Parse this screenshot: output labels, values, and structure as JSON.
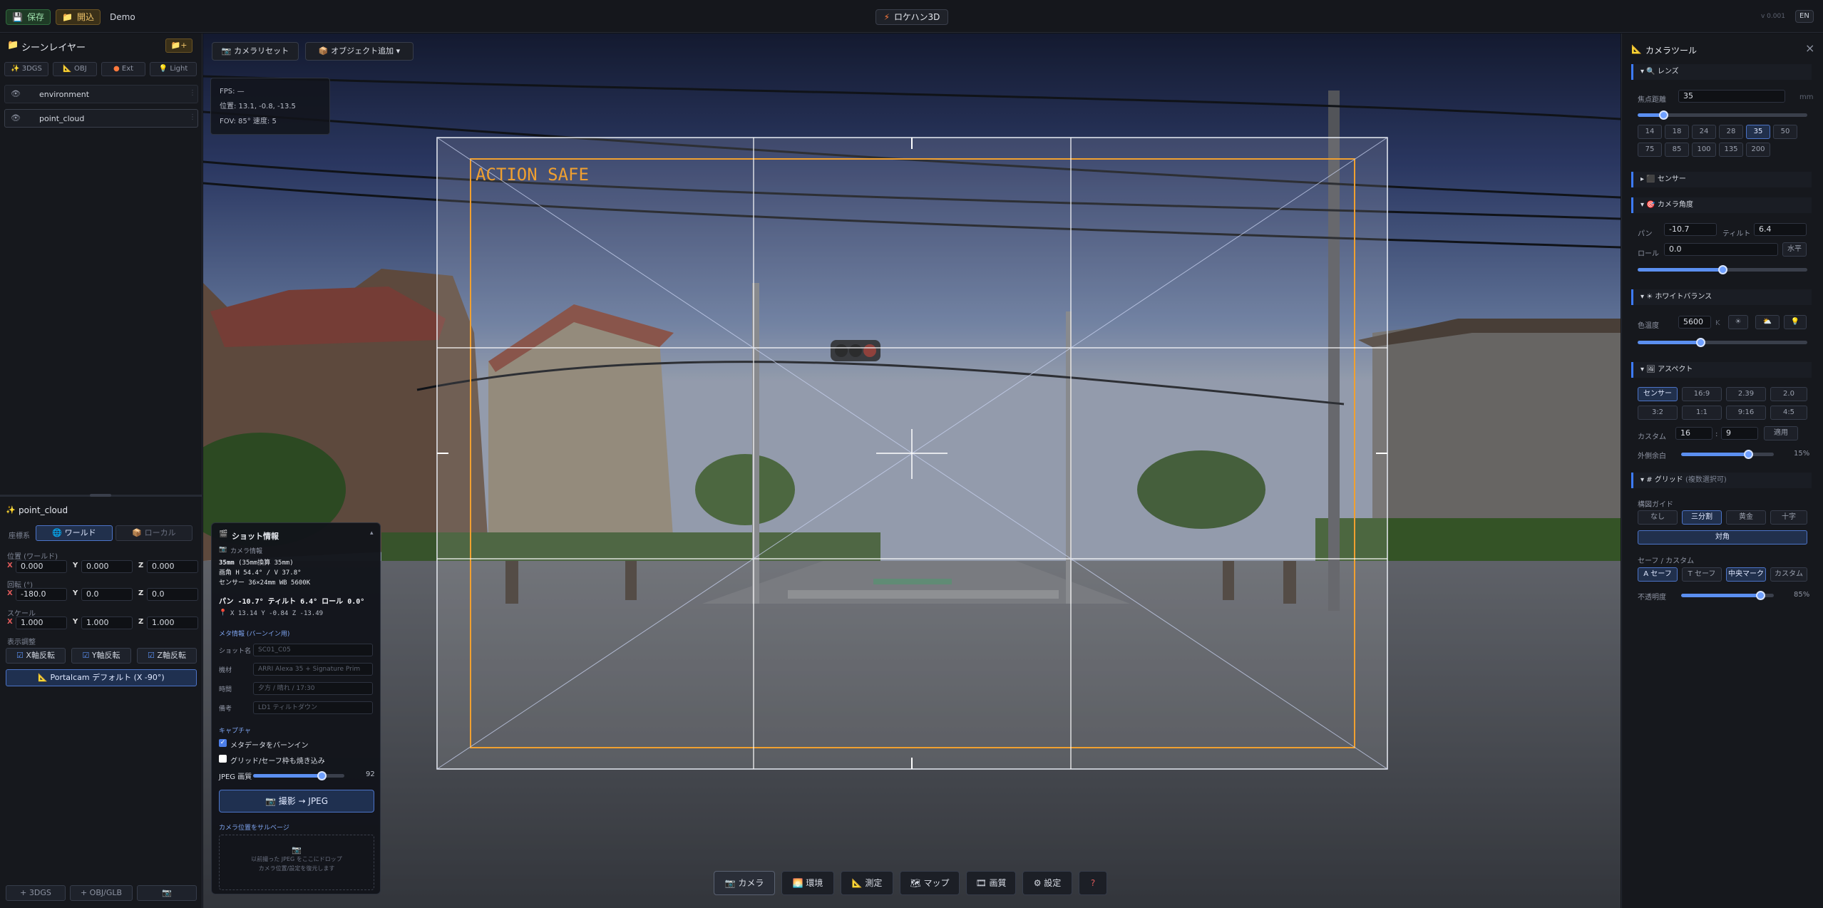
{
  "topbar": {
    "save": "保存",
    "open": "開込",
    "project": "Demo",
    "app_title": "ロケハン3D",
    "version": "v 0.001",
    "lang": "EN"
  },
  "layers": {
    "title": "シーンレイヤー",
    "add": "+",
    "filters": [
      "3DGS",
      "OBJ",
      "Ext",
      "Light"
    ],
    "items": [
      "environment",
      "point_cloud"
    ]
  },
  "props": {
    "title": "point_cloud",
    "coord_label": "座標系",
    "world": "ワールド",
    "local": "ローカル",
    "pos_label": "位置 (ワールド)",
    "rot_label": "回転 (°)",
    "scale_label": "スケール",
    "pos": [
      "0.000",
      "0.000",
      "0.000"
    ],
    "rot": [
      "-180.0",
      "0.0",
      "0.0"
    ],
    "scale": [
      "1.000",
      "1.000",
      "1.000"
    ],
    "display_label": "表示調整",
    "flipx": "X軸反転",
    "flipy": "Y軸反転",
    "flipz": "Z軸反転",
    "preset": "Portalcam デフォルト (X -90°)",
    "axes": [
      "X",
      "Y",
      "Z"
    ]
  },
  "bottom_left": {
    "add3dgs": "+ 3DGS",
    "addobj": "+ OBJ/GLB",
    "camera": "📷"
  },
  "viewport": {
    "reset": "カメラリセット",
    "add_object": "オブジェクト追加 ▾",
    "fps": "FPS: —",
    "pos": "位置: 13.1, -0.8, -13.5",
    "fov": "FOV: 85° 速度: 5",
    "action_safe": "ACTION SAFE"
  },
  "shot": {
    "title": "ショット情報",
    "cam_info": "カメラ情報",
    "lens": "35mm",
    "lens_sub": "(35mm換算 35mm)",
    "angle": "画角 H 54.4° / V 37.8°",
    "sensor": "センサー 36×24mm WB 5600K",
    "pan": "パン -10.7° ティルト 6.4° ロール 0.0°",
    "coords": "X 13.14  Y -0.84  Z -13.49",
    "meta_title": "メタ情報 (バーンイン用)",
    "shot_label": "ショット名",
    "shot_ph": "SC01_C05",
    "body_label": "機材",
    "body_ph": "ARRI Alexa 35 + Signature Prim",
    "time_label": "時間",
    "time_ph": "夕方 / 晴れ / 17:30",
    "note_label": "備考",
    "note_ph": "LD1 ティルトダウン",
    "capture": "キャプチャ",
    "burnin": "メタデータをバーンイン",
    "grid_opt": "グリッド/セーフ枠も焼き込み",
    "jpeg": "JPEG 画質",
    "jpeg_val": "92",
    "shoot": "撮影 → JPEG",
    "salvage": "カメラ位置をサルベージ",
    "drop1": "以前撮った JPEG をここにドロップ",
    "drop2": "カメラ位置/設定を復元します"
  },
  "dock": [
    "カメラ",
    "環境",
    "測定",
    "マップ",
    "画質",
    "設定",
    "?"
  ],
  "tools": {
    "title": "カメラツール",
    "lens": "レンズ",
    "focal_label": "焦点距離",
    "focal": "35",
    "mm": "mm",
    "focals": [
      "14",
      "18",
      "24",
      "28",
      "35",
      "50",
      "75",
      "85",
      "100",
      "135",
      "200"
    ],
    "sensor": "センサー",
    "angle": "カメラ角度",
    "pan_label": "パン",
    "pan": "-10.7",
    "tilt_label": "ティルト",
    "tilt": "6.4",
    "roll_label": "ロール",
    "roll": "0.0",
    "level": "水平",
    "wb": "ホワイトバランス",
    "temp_label": "色温度",
    "temp": "5600",
    "k": "K",
    "aspect": "アスペクト",
    "aspects": [
      "センサー",
      "16:9",
      "2.39",
      "2.0",
      "3:2",
      "1:1",
      "9:16",
      "4:5"
    ],
    "custom_label": "カスタム",
    "c1": "16",
    "c2": "9",
    "apply": "適用",
    "outside_label": "外側余白",
    "outside": "15%",
    "grid": "# グリッド",
    "grid_sub": "(複数選択可)",
    "comp_label": "構図ガイド",
    "comps": [
      "なし",
      "三分割",
      "黄金",
      "十字"
    ],
    "diag": "対角",
    "safe_label": "セーフ / カスタム",
    "safes": [
      "A セーフ",
      "T セーフ",
      "中央マーク",
      "カスタム"
    ],
    "opacity_label": "不透明度",
    "opacity": "85%"
  },
  "slider_levels": {
    "focal": 0.15,
    "roll": 0.5,
    "temp": 0.37,
    "outside": 0.72,
    "opacity": 0.85,
    "jpeg": 0.75
  }
}
